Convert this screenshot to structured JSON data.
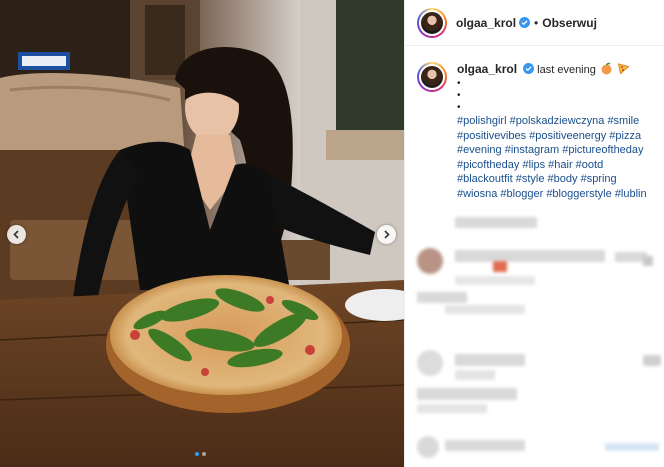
{
  "post": {
    "username": "olgaa_krol",
    "separator": "•",
    "follow_label": "Obserwuj",
    "caption_text": "last evening",
    "caption_bullets": [
      "•",
      "•",
      "•"
    ],
    "hashtags": [
      "#polishgirl",
      "#polskadziewczyna",
      "#smile",
      "#positivevibes",
      "#positiveenergy",
      "#pizza",
      "#evening",
      "#instagram",
      "#pictureoftheday",
      "#picoftheday",
      "#lips",
      "#hair",
      "#ootd",
      "#blackoutfit",
      "#style",
      "#body",
      "#spring",
      "#wiosna",
      "#blogger",
      "#bloggerstyle",
      "#lublin"
    ],
    "emojis": [
      "peach-emoji",
      "pizza-emoji"
    ]
  },
  "media": {
    "carousel_count": 2,
    "active_index": 1
  },
  "colors": {
    "verified": "#3897f0",
    "hashtag": "#1a4f8d",
    "text": "#262626",
    "carousel_active_dot": "#2f9bf0"
  }
}
